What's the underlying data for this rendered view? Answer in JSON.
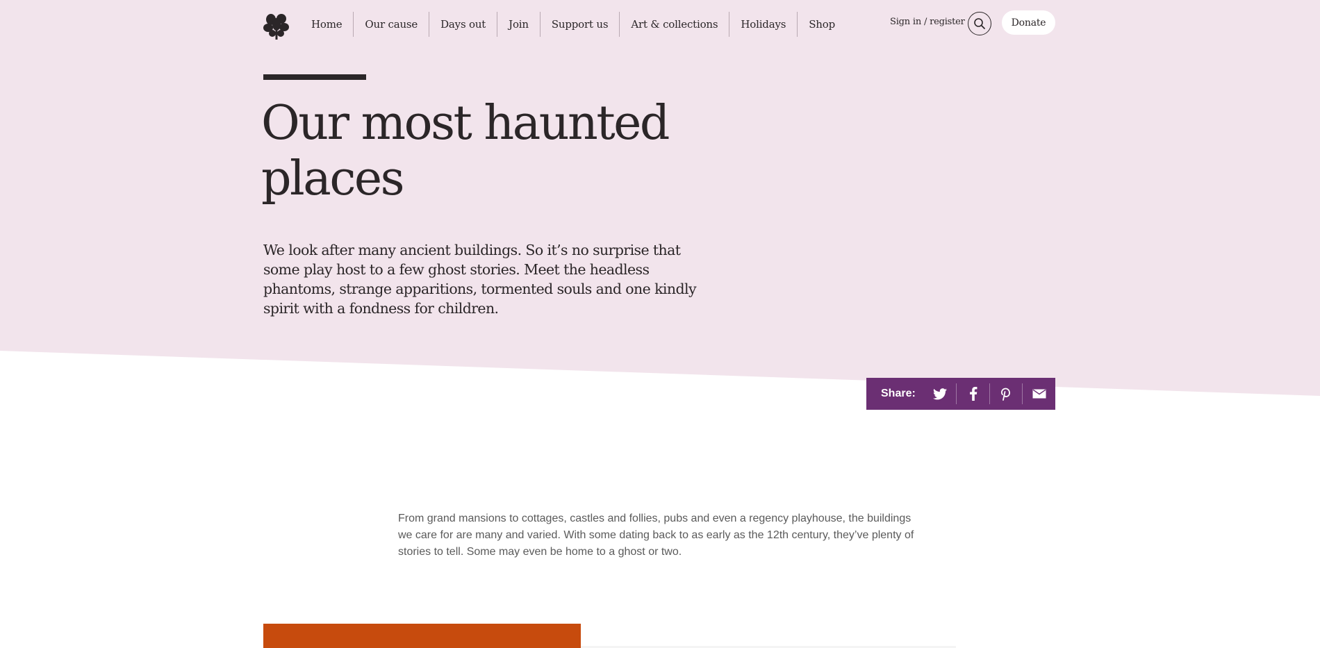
{
  "nav": {
    "items": [
      "Home",
      "Our cause",
      "Days out",
      "Join",
      "Support us",
      "Art & collections",
      "Holidays",
      "Shop"
    ]
  },
  "header": {
    "signin_label": "Sign in / register",
    "donate_label": "Donate",
    "logo_icon": "oak-leaf-logo",
    "search_icon": "search-icon"
  },
  "hero": {
    "title": "Our most haunted places",
    "intro": "We look after many ancient buildings. So it’s no surprise that some play host to a few ghost stories. Meet the headless phantoms, strange apparitions, tormented souls and one kindly spirit with a fondness for children."
  },
  "share": {
    "label": "Share:",
    "icons": [
      "twitter-icon",
      "facebook-icon",
      "pinterest-icon",
      "email-icon"
    ]
  },
  "content": {
    "paragraph": "From grand mansions to cottages, castles and follies, pubs and even a regency playhouse, the buildings we care for are many and varied. With some dating back to as early as the 12th century, they’ve plenty of stories to tell. Some may even be home to a ghost or two."
  },
  "colors": {
    "hero_bg": "#f2e4ec",
    "share_bg": "#6b2f73",
    "card_orange": "#c74b0d",
    "text_dark": "#2b2628"
  }
}
